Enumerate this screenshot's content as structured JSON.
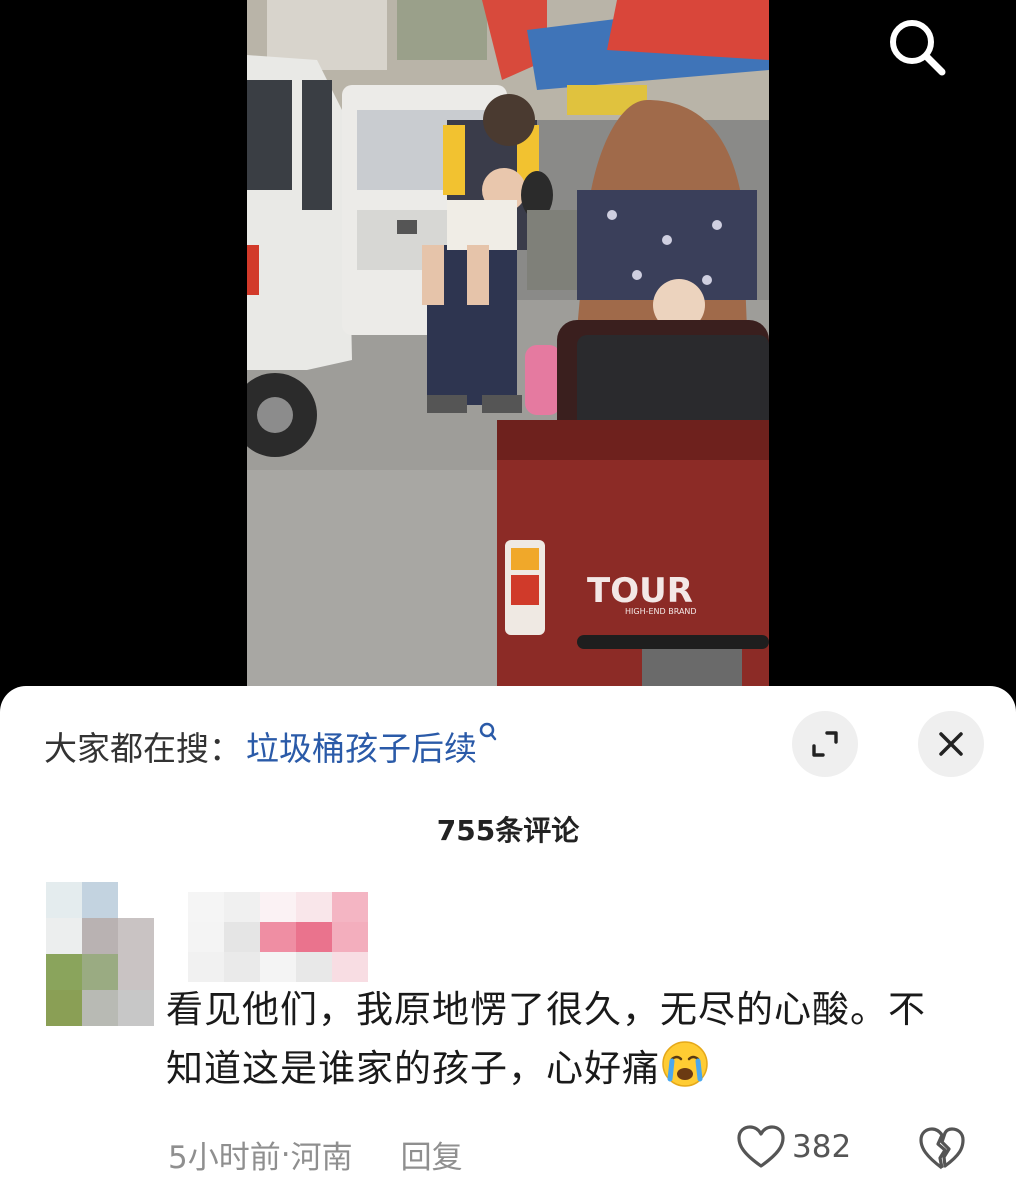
{
  "hot_search": {
    "prefix": "大家都在搜：",
    "term": "垃圾桶孩子后续"
  },
  "comments_panel": {
    "count_label": "755条评论"
  },
  "comment": {
    "text": "看见他们，我原地愣了很久，无尽的心酸。不知道这是谁家的孩子，心好痛",
    "emoji": "crying-face",
    "time": "5小时前",
    "separator": " · ",
    "location": "河南",
    "reply_label": "回复",
    "likes": "382"
  },
  "photo": {
    "vehicle_text": "TOUR",
    "vehicle_subtext": "HIGH-END BRAND"
  },
  "icons": {
    "search": "search-icon",
    "expand": "expand-icon",
    "close": "close-icon",
    "like": "heart-icon",
    "dislike": "broken-heart-icon"
  },
  "colors": {
    "link": "#2a5aa8",
    "muted": "#8f8f8f",
    "sheet_bg": "#ffffff"
  }
}
